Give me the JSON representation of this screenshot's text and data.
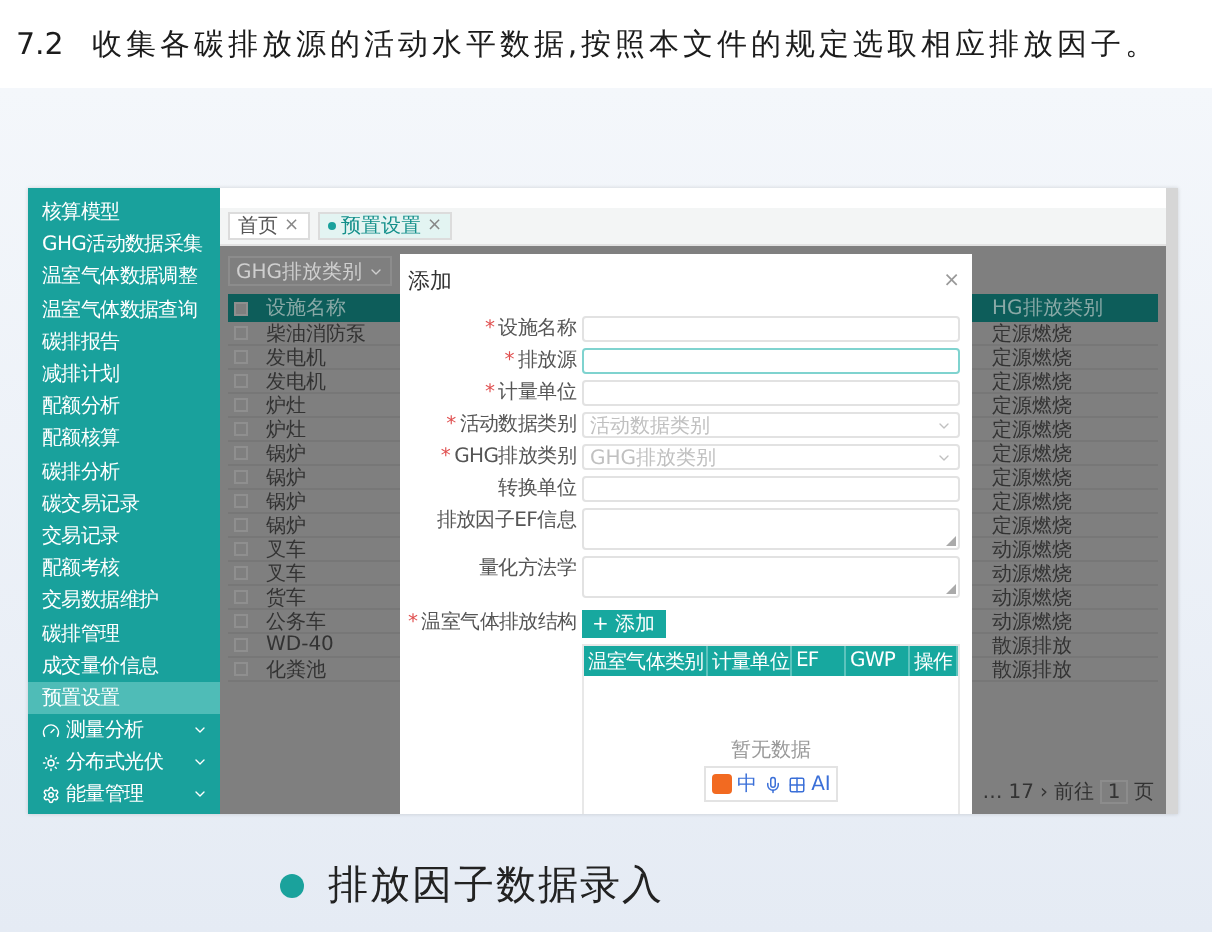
{
  "heading": {
    "number": "7.2",
    "text": "收集各碳排放源的活动水平数据,按照本文件的规定选取相应排放因子。"
  },
  "app": {
    "sidebar": {
      "items": [
        {
          "label": "核算模型",
          "selected": false,
          "kind": "link"
        },
        {
          "label": "GHG活动数据采集",
          "selected": false,
          "kind": "link"
        },
        {
          "label": "温室气体数据调整",
          "selected": false,
          "kind": "link"
        },
        {
          "label": "温室气体数据查询",
          "selected": false,
          "kind": "link"
        },
        {
          "label": "碳排报告",
          "selected": false,
          "kind": "link"
        },
        {
          "label": "减排计划",
          "selected": false,
          "kind": "link"
        },
        {
          "label": "配额分析",
          "selected": false,
          "kind": "link"
        },
        {
          "label": "配额核算",
          "selected": false,
          "kind": "link"
        },
        {
          "label": "碳排分析",
          "selected": false,
          "kind": "link"
        },
        {
          "label": "碳交易记录",
          "selected": false,
          "kind": "link"
        },
        {
          "label": "交易记录",
          "selected": false,
          "kind": "link"
        },
        {
          "label": "配额考核",
          "selected": false,
          "kind": "link"
        },
        {
          "label": "交易数据维护",
          "selected": false,
          "kind": "link"
        },
        {
          "label": "碳排管理",
          "selected": false,
          "kind": "link"
        },
        {
          "label": "成交量价信息",
          "selected": false,
          "kind": "link"
        },
        {
          "label": "预置设置",
          "selected": true,
          "kind": "link"
        },
        {
          "label": "测量分析",
          "selected": false,
          "kind": "group"
        },
        {
          "label": "分布式光伏",
          "selected": false,
          "kind": "group"
        },
        {
          "label": "能量管理",
          "selected": false,
          "kind": "group"
        }
      ]
    },
    "tabs": [
      {
        "label": "首页",
        "close": "×",
        "selected": false
      },
      {
        "label": "预置设置",
        "close": "×",
        "selected": true
      }
    ],
    "filter": {
      "placeholder": "GHG排放类别"
    },
    "table": {
      "header_checked": false,
      "columns": [
        "设施名称",
        "HG排放类别"
      ],
      "rows": [
        {
          "cells": [
            "柴油消防泵",
            "定源燃烧"
          ],
          "checked": false
        },
        {
          "cells": [
            "发电机",
            "定源燃烧"
          ],
          "checked": false
        },
        {
          "cells": [
            "发电机",
            "定源燃烧"
          ],
          "checked": false
        },
        {
          "cells": [
            "炉灶",
            "定源燃烧"
          ],
          "checked": false
        },
        {
          "cells": [
            "炉灶",
            "定源燃烧"
          ],
          "checked": false
        },
        {
          "cells": [
            "锅炉",
            "定源燃烧"
          ],
          "checked": false
        },
        {
          "cells": [
            "锅炉",
            "定源燃烧"
          ],
          "checked": false
        },
        {
          "cells": [
            "锅炉",
            "定源燃烧"
          ],
          "checked": false
        },
        {
          "cells": [
            "锅炉",
            "定源燃烧"
          ],
          "checked": false
        },
        {
          "cells": [
            "叉车",
            "动源燃烧"
          ],
          "checked": false
        },
        {
          "cells": [
            "叉车",
            "动源燃烧"
          ],
          "checked": false
        },
        {
          "cells": [
            "货车",
            "动源燃烧"
          ],
          "checked": false
        },
        {
          "cells": [
            "公务车",
            "动源燃烧"
          ],
          "checked": false
        },
        {
          "cells": [
            "WD-40",
            "散源排放"
          ],
          "checked": false
        },
        {
          "cells": [
            "化粪池",
            "散源排放"
          ],
          "checked": false
        }
      ]
    },
    "pagination": {
      "pages": [
        "…",
        "17"
      ],
      "next": "›",
      "goto_label": "前往",
      "page": "1",
      "page_suffix": "页"
    },
    "dialog": {
      "title": "添加",
      "close": "×",
      "required_mark": "*",
      "fields": [
        {
          "label": "设施名称",
          "required": true,
          "kind": "input",
          "focused": false
        },
        {
          "label": "排放源",
          "required": true,
          "kind": "input",
          "focused": true
        },
        {
          "label": "计量单位",
          "required": true,
          "kind": "input",
          "focused": false
        },
        {
          "label": "活动数据类别",
          "required": true,
          "kind": "select",
          "placeholder": "活动数据类别",
          "focused": false
        },
        {
          "label": "GHG排放类别",
          "required": true,
          "kind": "select",
          "placeholder": "GHG排放类别",
          "focused": false
        },
        {
          "label": "转换单位",
          "required": false,
          "kind": "input",
          "focused": false
        },
        {
          "label": "排放因子EF信息",
          "required": false,
          "kind": "textarea",
          "focused": false
        },
        {
          "label": "量化方法学",
          "required": false,
          "kind": "textarea",
          "focused": false
        }
      ],
      "structure": {
        "label": "温室气体排放结构",
        "required": true,
        "add_button": "+ 添加",
        "columns": [
          "温室气体类别",
          "计量单位",
          "EF",
          "GWP",
          "操作"
        ],
        "empty": "暂无数据"
      },
      "ime": {
        "mode": "中",
        "ai": "AI"
      }
    }
  },
  "caption": "排放因子数据录入"
}
